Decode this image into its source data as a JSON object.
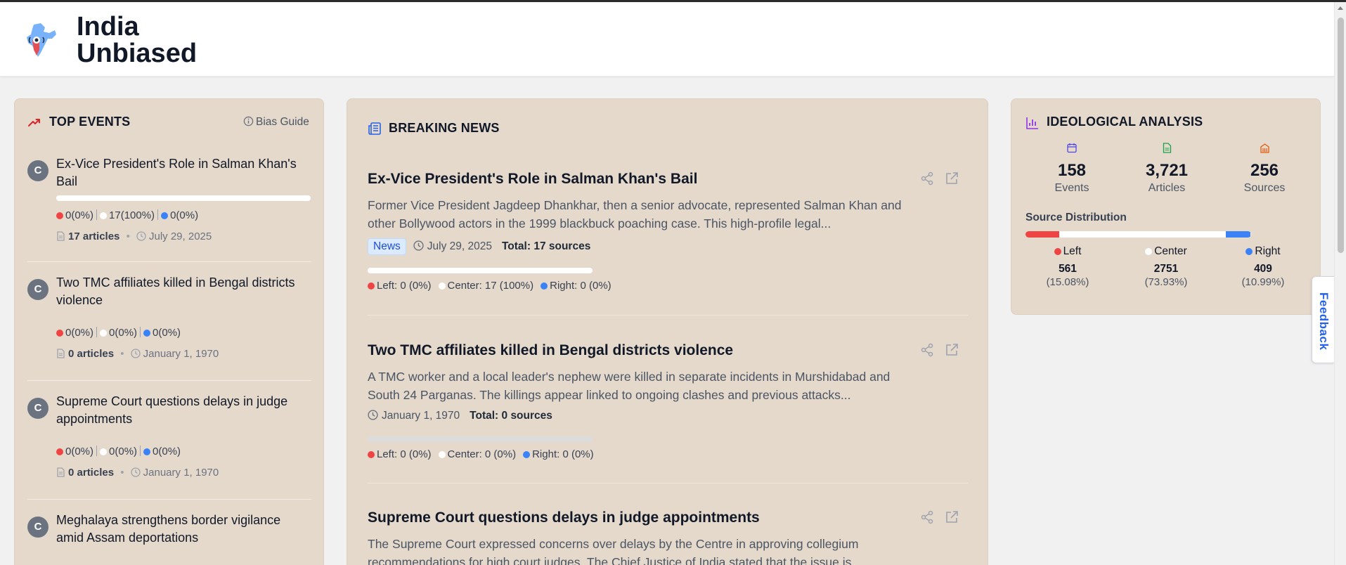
{
  "header": {
    "brand_line1": "India",
    "brand_line2": "Unbiased"
  },
  "top_events": {
    "title": "TOP EVENTS",
    "bias_guide": "Bias Guide",
    "items": [
      {
        "badge": "C",
        "title": "Ex-Vice President's Role in Salman Khan's Bail",
        "left": "0(0%)",
        "center": "17(100%)",
        "right": "0(0%)",
        "articles": "17 articles",
        "date": "July 29, 2025",
        "center_fraction": 1.0
      },
      {
        "badge": "C",
        "title": "Two TMC affiliates killed in Bengal districts violence",
        "left": "0(0%)",
        "center": "0(0%)",
        "right": "0(0%)",
        "articles": "0 articles",
        "date": "January 1, 1970"
      },
      {
        "badge": "C",
        "title": "Supreme Court questions delays in judge appointments",
        "left": "0(0%)",
        "center": "0(0%)",
        "right": "0(0%)",
        "articles": "0 articles",
        "date": "January 1, 1970"
      },
      {
        "badge": "C",
        "title": "Meghalaya strengthens border vigilance amid Assam deportations"
      }
    ]
  },
  "breaking_news": {
    "title": "BREAKING NEWS",
    "items": [
      {
        "title": "Ex-Vice President's Role in Salman Khan's Bail",
        "description": "Former Vice President Jagdeep Dhankhar, then a senior advocate, represented Salman Khan and other Bollywood actors in the 1999 blackbuck poaching case. This high-profile legal...",
        "tag": "News",
        "date": "July 29, 2025",
        "total": "Total: 17 sources",
        "left": "Left: 0 (0%)",
        "center": "Center: 17 (100%)",
        "right": "Right: 0 (0%)",
        "center_fraction": 1.0
      },
      {
        "title": "Two TMC affiliates killed in Bengal districts violence",
        "description": "A TMC worker and a local leader's nephew were killed in separate incidents in Murshidabad and South 24 Parganas. The killings appear linked to ongoing clashes and previous attacks...",
        "date": "January 1, 1970",
        "total": "Total: 0 sources",
        "left": "Left: 0 (0%)",
        "center": "Center: 0 (0%)",
        "right": "Right: 0 (0%)"
      },
      {
        "title": "Supreme Court questions delays in judge appointments",
        "description": "The Supreme Court expressed concerns over delays by the Centre in approving collegium recommendations for high court judges. The Chief Justice of India stated that the issue is"
      }
    ]
  },
  "ideology": {
    "title": "IDEOLOGICAL ANALYSIS",
    "stats": [
      {
        "value": "158",
        "label": "Events",
        "color": "#4f46e5"
      },
      {
        "value": "3,721",
        "label": "Articles",
        "color": "#16a34a"
      },
      {
        "value": "256",
        "label": "Sources",
        "color": "#ea580c"
      }
    ],
    "distribution_label": "Source Distribution",
    "distribution": [
      {
        "name": "Left",
        "count": "561",
        "pct": "(15.08%)",
        "fraction": 0.1508,
        "color": "#ef4444"
      },
      {
        "name": "Center",
        "count": "2751",
        "pct": "(73.93%)",
        "fraction": 0.7393,
        "color": "#ffffff"
      },
      {
        "name": "Right",
        "count": "409",
        "pct": "(10.99%)",
        "fraction": 0.1099,
        "color": "#3b82f6"
      }
    ]
  },
  "feedback": "Feedback"
}
